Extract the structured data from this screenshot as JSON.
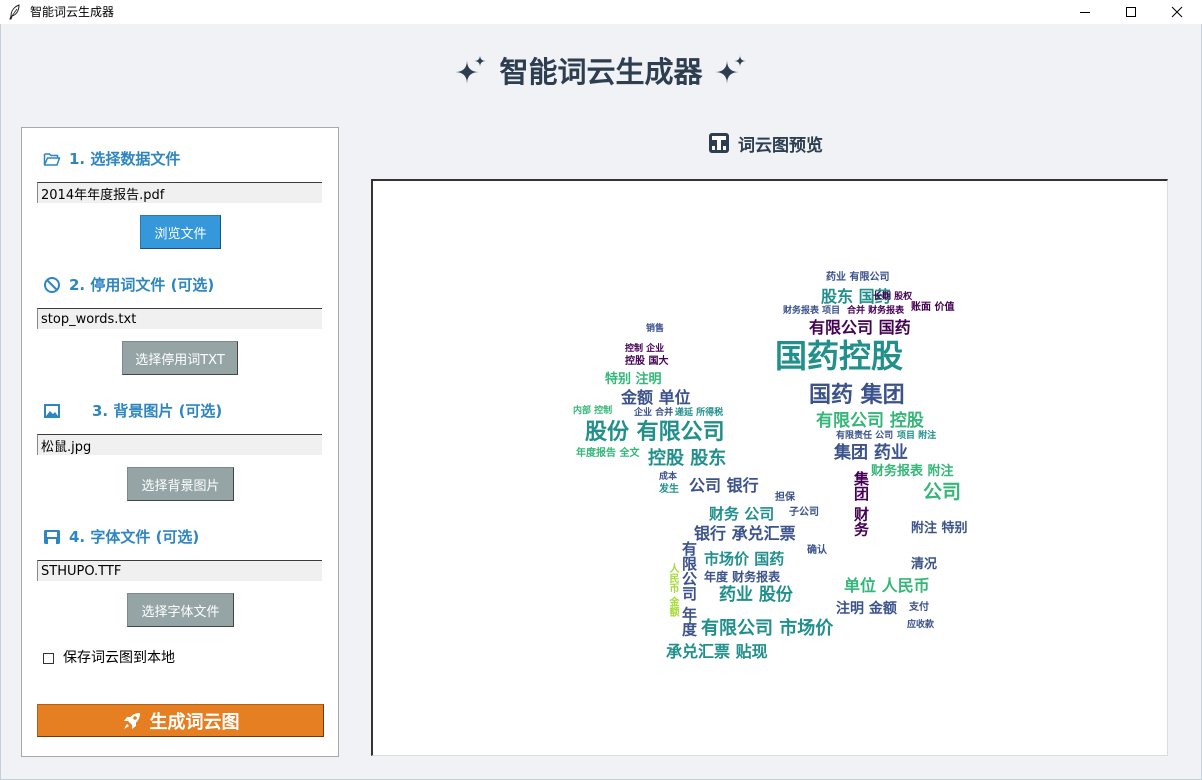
{
  "window": {
    "title": "智能词云生成器",
    "controls": [
      "minimize",
      "maximize",
      "close"
    ]
  },
  "app": {
    "title": "智能词云生成器"
  },
  "sections": [
    {
      "label": "1. 选择数据文件",
      "value": "2014年年度报告.pdf",
      "button": "浏览文件"
    },
    {
      "label": "2. 停用词文件 (可选)",
      "value": "stop_words.txt",
      "button": "选择停用词TXT"
    },
    {
      "label": "3. 背景图片 (可选)",
      "value": "松鼠.jpg",
      "button": "选择背景图片"
    },
    {
      "label": "4. 字体文件 (可选)",
      "value": "STHUPO.TTF",
      "button": "选择字体文件"
    }
  ],
  "save_option": {
    "label": "保存词云图到本地",
    "checked": false
  },
  "generate_button": {
    "label": "生成词云图"
  },
  "preview": {
    "title": "词云图预览"
  },
  "icons": {
    "title_bar": "feather-icon",
    "title": "sparkles-icon",
    "section_1": "folder-open-icon",
    "section_2": "no-entry-icon",
    "section_3": "picture-icon",
    "section_4": "floppy-disk-icon",
    "preview": "chart-icon",
    "generate": "rocket-icon"
  },
  "colors": {
    "title_text": "#2c3e50",
    "section_header": "#2e86c1",
    "browse_button": "#3498db",
    "secondary_button": "#95a5a6",
    "generate_button": "#e67e22",
    "wordcloud_palette": [
      "#440154",
      "#3b528b",
      "#21908d",
      "#35b779",
      "#a5db36"
    ]
  },
  "wordcloud": {
    "words": [
      "药业 有限公司",
      "股东 国药",
      "长期 股权",
      "财务报表 项目",
      "合并 财务报表",
      "账面 价值",
      "有限公司 国药",
      "国药控股",
      "国药 集团",
      "有限公司 控股",
      "集团 药业",
      "财务报表 附注",
      "公司",
      "附注 特别",
      "清况",
      "单位 人民币",
      "注明 金额",
      "支付",
      "应收款",
      "销售",
      "控制 企业",
      "控股 国大",
      "特别 注明",
      "金额 单位",
      "内部 控制",
      "企业 合并",
      "递延 所得税",
      "股份 有限公司",
      "年度报告 全文",
      "控股 股东",
      "成本",
      "发生",
      "公司 银行",
      "担保",
      "财务 公司",
      "子公司",
      "银行 承兑汇票",
      "确认",
      "市场价 国药",
      "年度 财务报表",
      "药业 股份",
      "有限公司 市场价",
      "承兑汇票 贴现",
      "有限公司 年度",
      "集团 财务",
      "有限责任 公司",
      "项目 附注",
      "人民币 金额"
    ]
  }
}
